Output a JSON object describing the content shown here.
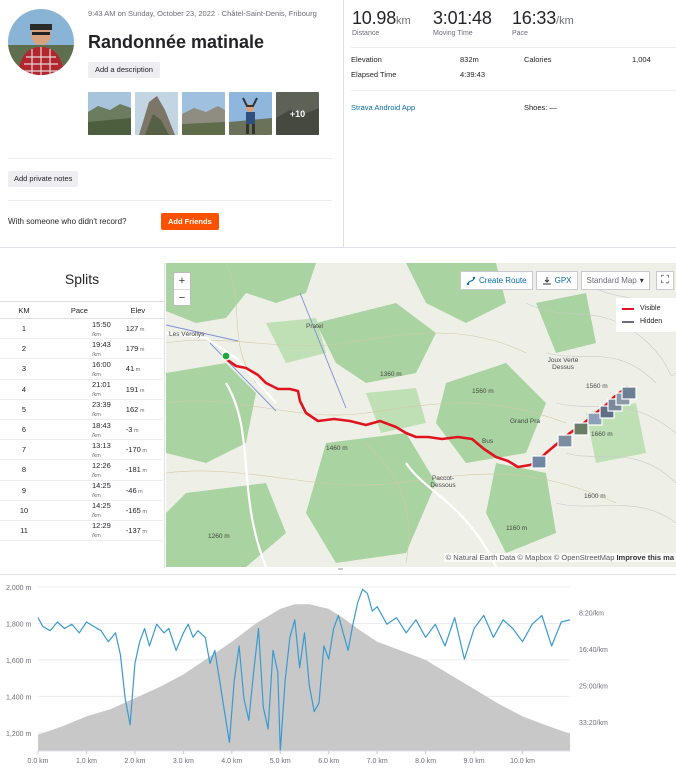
{
  "activity": {
    "meta": "9:43 AM on Sunday, October 23, 2022 · Châtel-Saint-Denis, Fribourg",
    "title": "Randonnée matinale",
    "add_description": "Add a description",
    "photos_more": "+10",
    "add_private_notes": "Add private notes",
    "with_someone": "With someone who didn't record?",
    "add_friends": "Add Friends"
  },
  "stats": {
    "distance": {
      "value": "10.98",
      "unit": "km",
      "label": "Distance"
    },
    "moving_time": {
      "value": "3:01:48",
      "label": "Moving Time"
    },
    "pace": {
      "value": "16:33",
      "unit": "/km",
      "label": "Pace"
    },
    "elevation": {
      "label": "Elevation",
      "value": "832m"
    },
    "calories": {
      "label": "Calories",
      "value": "1,004"
    },
    "elapsed": {
      "label": "Elapsed Time",
      "value": "4:39:43"
    },
    "device": "Strava Android App",
    "shoes": "Shoes: —"
  },
  "splits": {
    "title": "Splits",
    "headers": [
      "KM",
      "Pace",
      "Elev"
    ],
    "pace_unit": "/km",
    "elev_unit": "m",
    "rows": [
      {
        "km": "1",
        "pace": "15:50",
        "elev": "127"
      },
      {
        "km": "2",
        "pace": "19:43",
        "elev": "179"
      },
      {
        "km": "3",
        "pace": "16:00",
        "elev": "41"
      },
      {
        "km": "4",
        "pace": "21:01",
        "elev": "191"
      },
      {
        "km": "5",
        "pace": "23:39",
        "elev": "162"
      },
      {
        "km": "6",
        "pace": "18:43",
        "elev": "-3"
      },
      {
        "km": "7",
        "pace": "13:13",
        "elev": "-170"
      },
      {
        "km": "8",
        "pace": "12:26",
        "elev": "-181"
      },
      {
        "km": "9",
        "pace": "14:25",
        "elev": "-46"
      },
      {
        "km": "10",
        "pace": "14:25",
        "elev": "-165"
      },
      {
        "km": "11",
        "pace": "12:29",
        "elev": "-137"
      }
    ]
  },
  "map": {
    "zoom_in": "+",
    "zoom_out": "−",
    "create_route": "Create Route",
    "gpx": "GPX",
    "style": "Standard Map",
    "legend_visible": "Visible",
    "legend_hidden": "Hidden",
    "attribution": "© Natural Earth Data © Mapbox © OpenStreetMap",
    "improve": "Improve this ma",
    "labels": {
      "veroliys": "Les Véroliys",
      "joux": "Joux Verte Dessus",
      "grand_pra": "Grand Pra",
      "paccot": "Paccot-Dessous",
      "bus": "Bus",
      "pratel": "Pratel",
      "c1360": "1360 m",
      "c1460": "1460 m",
      "c1260": "1260 m",
      "c1160": "1160 m",
      "c1560": "1560 m",
      "c1600": "1600 m",
      "c1660": "1660 m",
      "c1560b": "1560 m"
    },
    "colors": {
      "route": "#e0141e",
      "hidden": "#6b6b7b",
      "forest": "#a9d3a0",
      "start": "#1fa83d"
    }
  },
  "chart_data": {
    "type": "area",
    "xlabel": "",
    "x_ticks": [
      "0.0 km",
      "1.0 km",
      "2.0 km",
      "3.0 km",
      "4.0 km",
      "5.0 km",
      "6.0 km",
      "7.0 km",
      "8.0 km",
      "9.0 km",
      "10.0 km"
    ],
    "y_left_ticks": [
      "2,000 m",
      "1,800 m",
      "1,600 m",
      "1,400 m",
      "1,200 m"
    ],
    "y_right_ticks": [
      "8:20/km",
      "16:40/km",
      "25:00/km",
      "33:20/km"
    ],
    "xlim": [
      0,
      10.98
    ],
    "ylim": [
      1100,
      2000
    ],
    "series": [
      {
        "kind": "elevation",
        "color": "#c8c8c8",
        "x": [
          0,
          0.5,
          1.0,
          1.5,
          2.0,
          2.5,
          3.0,
          3.5,
          4.0,
          4.5,
          5.0,
          5.3,
          5.6,
          6.0,
          6.3,
          6.6,
          7.0,
          7.5,
          8.0,
          8.5,
          9.0,
          9.5,
          10.0,
          10.5,
          10.98
        ],
        "values": [
          1190,
          1235,
          1290,
          1330,
          1390,
          1450,
          1520,
          1610,
          1700,
          1800,
          1880,
          1905,
          1905,
          1880,
          1830,
          1770,
          1700,
          1650,
          1600,
          1520,
          1440,
          1360,
          1290,
          1240,
          1195
        ]
      },
      {
        "kind": "pace",
        "color": "#3a9ad0",
        "x": [
          0,
          0.1,
          0.25,
          0.4,
          0.55,
          0.7,
          0.85,
          1.0,
          1.15,
          1.3,
          1.45,
          1.6,
          1.7,
          1.8,
          1.9,
          2.0,
          2.1,
          2.2,
          2.3,
          2.45,
          2.6,
          2.7,
          2.85,
          3.0,
          3.1,
          3.2,
          3.3,
          3.45,
          3.55,
          3.65,
          3.75,
          3.85,
          3.95,
          4.05,
          4.15,
          4.25,
          4.35,
          4.45,
          4.55,
          4.65,
          4.75,
          4.85,
          4.95,
          5.0,
          5.1,
          5.2,
          5.3,
          5.4,
          5.5,
          5.6,
          5.7,
          5.8,
          5.9,
          6.0,
          6.1,
          6.2,
          6.3,
          6.4,
          6.5,
          6.6,
          6.7,
          6.8,
          6.9,
          7.0,
          7.2,
          7.4,
          7.6,
          7.8,
          8.0,
          8.2,
          8.4,
          8.6,
          8.8,
          9.0,
          9.2,
          9.4,
          9.6,
          9.8,
          10.0,
          10.2,
          10.4,
          10.6,
          10.8,
          10.98
        ],
        "values": [
          9.5,
          11.5,
          12.5,
          10.5,
          12,
          11,
          13,
          10.5,
          11.5,
          12.5,
          15,
          13,
          18,
          28,
          34,
          20,
          15,
          12,
          16,
          11,
          13,
          12,
          17,
          13,
          11,
          14,
          12.5,
          14,
          20,
          17,
          24,
          31,
          38,
          24,
          16,
          28,
          33,
          22,
          12,
          30,
          35,
          17,
          22,
          40,
          24,
          14,
          10,
          21,
          13,
          25,
          31,
          29,
          16,
          19,
          12,
          9,
          13,
          17,
          11,
          6,
          3,
          4,
          8,
          7,
          11,
          9.5,
          13,
          10,
          14,
          11,
          16,
          9.5,
          19,
          12,
          9,
          14,
          10,
          12,
          15,
          11,
          9,
          16,
          10.5,
          10
        ]
      }
    ]
  }
}
